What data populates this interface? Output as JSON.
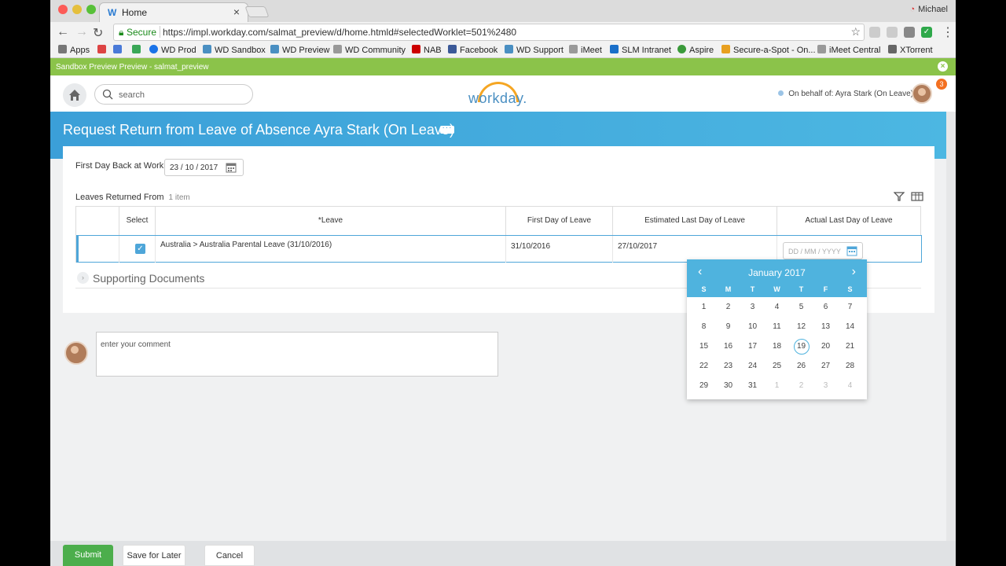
{
  "browser": {
    "tab_title": "Home",
    "user": "Michael",
    "secure_label": "Secure",
    "url": "https://impl.workday.com/salmat_preview/d/home.htmld#selectedWorklet=501%2480",
    "bookmarks": [
      "Apps",
      "WD Prod",
      "WD Sandbox",
      "WD Preview",
      "WD Community",
      "NAB",
      "Facebook",
      "WD Support",
      "iMeet",
      "SLM Intranet",
      "Aspire",
      "Secure-a-Spot - On...",
      "iMeet Central",
      "XTorrent"
    ]
  },
  "sandbox_banner": "Sandbox Preview Preview - salmat_preview",
  "header": {
    "search_placeholder": "search",
    "logo_text": "workday.",
    "on_behalf": "On behalf of: Ayra Stark (On Leave)",
    "notification_count": "3"
  },
  "page": {
    "title": "Request Return from Leave of Absence  Ayra Stark (On Leave)",
    "first_day_label": "First Day Back at Work",
    "first_day_value": "23 / 10 / 2017",
    "leaves_label": "Leaves Returned From",
    "leaves_count": "1 item"
  },
  "table": {
    "headers": [
      "Select",
      "*Leave",
      "First Day of Leave",
      "Estimated Last Day of Leave",
      "Actual Last Day of Leave"
    ],
    "row": {
      "leave": "Australia > Australia Parental Leave (31/10/2016)",
      "first_day": "31/10/2016",
      "est_last_day": "27/10/2017",
      "actual_placeholder": "DD / MM / YYYY"
    }
  },
  "supporting_documents": "Supporting Documents",
  "comment_placeholder": "enter your comment",
  "calendar": {
    "month": "January 2017",
    "weekdays": [
      "S",
      "M",
      "T",
      "W",
      "T",
      "F",
      "S"
    ],
    "today": "19",
    "weeks": [
      [
        "1",
        "2",
        "3",
        "4",
        "5",
        "6",
        "7"
      ],
      [
        "8",
        "9",
        "10",
        "11",
        "12",
        "13",
        "14"
      ],
      [
        "15",
        "16",
        "17",
        "18",
        "19",
        "20",
        "21"
      ],
      [
        "22",
        "23",
        "24",
        "25",
        "26",
        "27",
        "28"
      ],
      [
        "29",
        "30",
        "31",
        "1",
        "2",
        "3",
        "4"
      ]
    ]
  },
  "footer": {
    "submit": "Submit",
    "save_later": "Save for Later",
    "cancel": "Cancel"
  },
  "colors": {
    "accent": "#4fb3de",
    "sandbox": "#8bc34a",
    "submit": "#4cae4c"
  }
}
